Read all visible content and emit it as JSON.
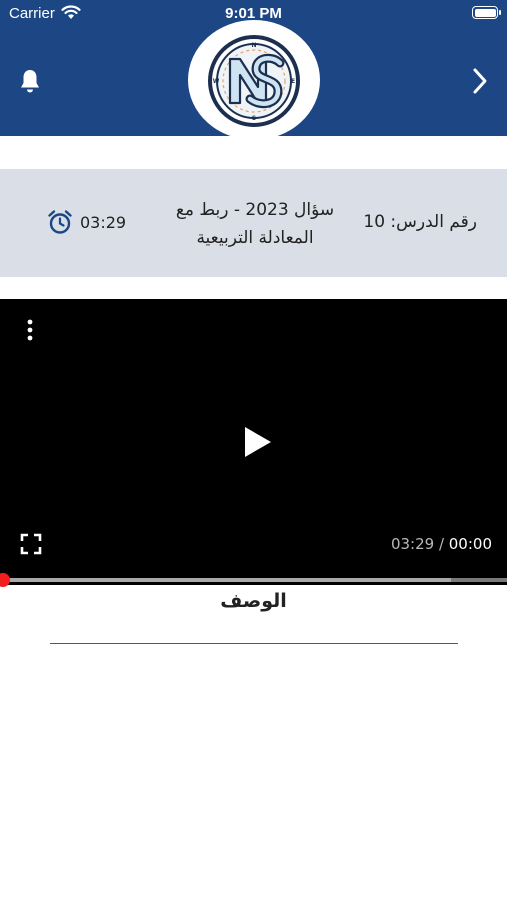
{
  "status_bar": {
    "carrier": "Carrier",
    "time": "9:01 PM",
    "wifi_icon": "wifi-icon",
    "battery_icon": "battery-icon"
  },
  "header": {
    "background_color": "#1c4684",
    "bell_icon": "bell-icon",
    "back_icon": "chevron-right-icon",
    "logo_icon": "compass-logo",
    "logo_letters": "NS",
    "compass_points": [
      "N",
      "E",
      "S",
      "W"
    ]
  },
  "lesson_info": {
    "number_label": "رقم الدرس: 10",
    "title_line1": "سؤال 2023 - ربط مع",
    "title_line2": "المعادلة التربيعية",
    "duration": "03:29",
    "alarm_icon": "alarm-clock-icon"
  },
  "video_player": {
    "current_time": "00:00",
    "separator": " / ",
    "total_time": "03:29",
    "progress": 0,
    "buffered": 0.89,
    "play_icon": "play-icon",
    "menu_icon": "more-vertical-icon",
    "fullscreen_icon": "fullscreen-icon",
    "knob_color": "#f21d1d"
  },
  "description": {
    "heading": "الوصف",
    "rule_color": "#3a5c90"
  }
}
